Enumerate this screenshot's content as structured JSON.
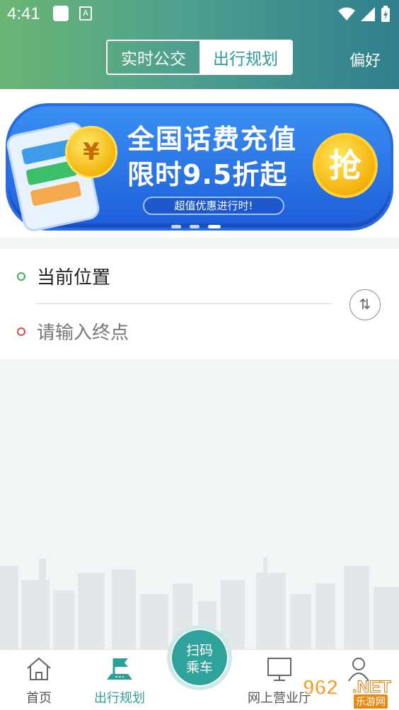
{
  "status_bar": {
    "time": "4:41",
    "a_label": "A"
  },
  "header": {
    "tabs": [
      {
        "label": "实时公交",
        "active": true
      },
      {
        "label": "出行规划",
        "active": false
      }
    ],
    "preference_label": "偏好"
  },
  "banner": {
    "line1": "全国话费充值",
    "line2": "限时9.5折起",
    "subtitle": "超值优惠进行时!",
    "coin_symbol": "¥",
    "action_label": "抢",
    "indicator_count": 3,
    "indicator_active": 2
  },
  "route": {
    "origin": "当前位置",
    "destination_placeholder": "请输入终点",
    "swap_glyph": "⇅"
  },
  "bottom_nav": {
    "items": [
      {
        "label": "首页",
        "icon": "home-icon"
      },
      {
        "label": "出行规划",
        "icon": "trip-plan-icon",
        "active": true
      },
      {
        "label": "网上营业厅",
        "icon": "monitor-icon"
      },
      {
        "label": "",
        "icon": "user-icon"
      }
    ],
    "scan_line1": "扫码",
    "scan_line2": "乘车"
  },
  "watermark": {
    "main": "962",
    "suffix": ".NET",
    "sub": "乐游网"
  },
  "colors": {
    "accent": "#2aa09b",
    "header_left": "#6bb574",
    "header_right": "#2f7f8e",
    "banner": "#1d5ed9"
  }
}
